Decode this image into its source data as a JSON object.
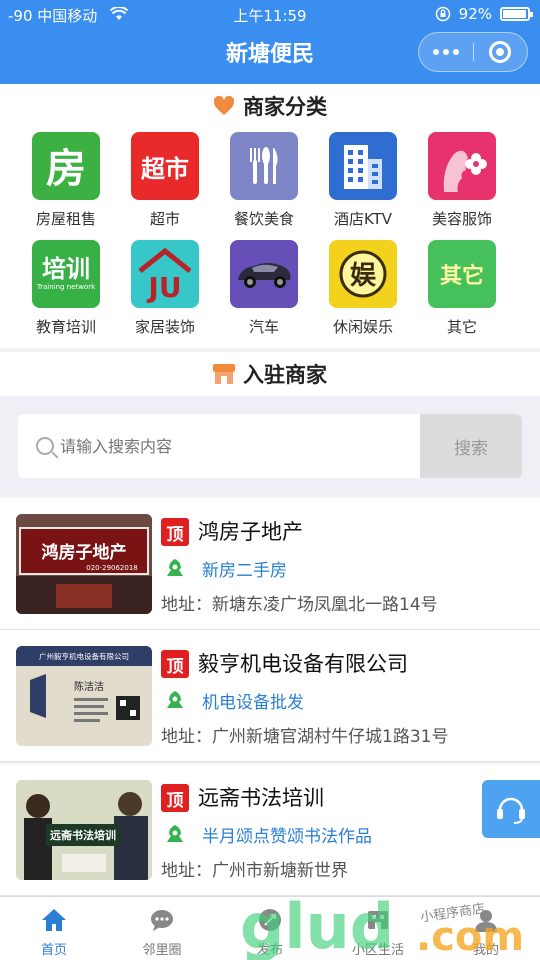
{
  "status": {
    "carrier": "-90 中国移动",
    "time": "上午11:59",
    "battery": "92%"
  },
  "nav": {
    "title": "新塘便民"
  },
  "categories_section": {
    "title": "商家分类"
  },
  "categories": [
    {
      "label": "房屋租售",
      "glyph": "房",
      "color": "#3cb043"
    },
    {
      "label": "超市",
      "glyph": "超市",
      "color": "#e82a2a"
    },
    {
      "label": "餐饮美食",
      "glyph": "",
      "color": "#7e86c8",
      "icon": "cutlery-icon"
    },
    {
      "label": "酒店KTV",
      "glyph": "",
      "color": "#2f6dd0",
      "icon": "building-icon"
    },
    {
      "label": "美容服饰",
      "glyph": "",
      "color": "#e8326e",
      "icon": "face-flower-icon"
    },
    {
      "label": "教育培训",
      "glyph": "培训",
      "sub": "Training network",
      "color": "#37b045"
    },
    {
      "label": "家居装饰",
      "glyph": "JU",
      "color": "#38c7c8"
    },
    {
      "label": "汽车",
      "glyph": "",
      "color": "#6650b8",
      "icon": "car-icon"
    },
    {
      "label": "休闲娱乐",
      "glyph": "娱",
      "color": "#f2d21c"
    },
    {
      "label": "其它",
      "glyph": "其它",
      "color": "#45c05a"
    }
  ],
  "merchants_section": {
    "title": "入驻商家"
  },
  "search": {
    "placeholder": "请输入搜索内容",
    "button": "搜索"
  },
  "merchants": [
    {
      "badge": "顶",
      "name": "鸿房子地产",
      "tag": "新房二手房",
      "address": "地址：新塘东凌广场凤凰北一路14号",
      "photo_sign": "鸿房子地产",
      "photo_phone": "020-29062018"
    },
    {
      "badge": "顶",
      "name": "毅亨机电设备有限公司",
      "tag": "机电设备批发",
      "address": "地址：广州新塘官湖村牛仔城1路31号",
      "photo_sign": "广州毅亨机电设备有限公司",
      "photo_person": "陈洁洁"
    },
    {
      "badge": "顶",
      "name": "远斋书法培训",
      "tag": "半月颂点赞颂书法作品",
      "address": "地址：广州市新塘新世界",
      "photo_sign": "远斋书法培训"
    }
  ],
  "tabs": [
    {
      "label": "首页",
      "icon": "home-icon",
      "active": true
    },
    {
      "label": "邻里圈",
      "icon": "chat-icon",
      "active": false
    },
    {
      "label": "发布",
      "icon": "publish-icon",
      "active": false
    },
    {
      "label": "小区生活",
      "icon": "community-icon",
      "active": false
    },
    {
      "label": "我的",
      "icon": "user-icon",
      "active": false
    }
  ],
  "watermark": {
    "text1": "glud",
    "text2": ".com",
    "text3": "小程序商店"
  },
  "colors": {
    "primary": "#3a8ef0",
    "accent": "#f08a3c",
    "badge": "#e02020",
    "tag": "#2a7fd4",
    "tag_icon": "#34b34f"
  }
}
